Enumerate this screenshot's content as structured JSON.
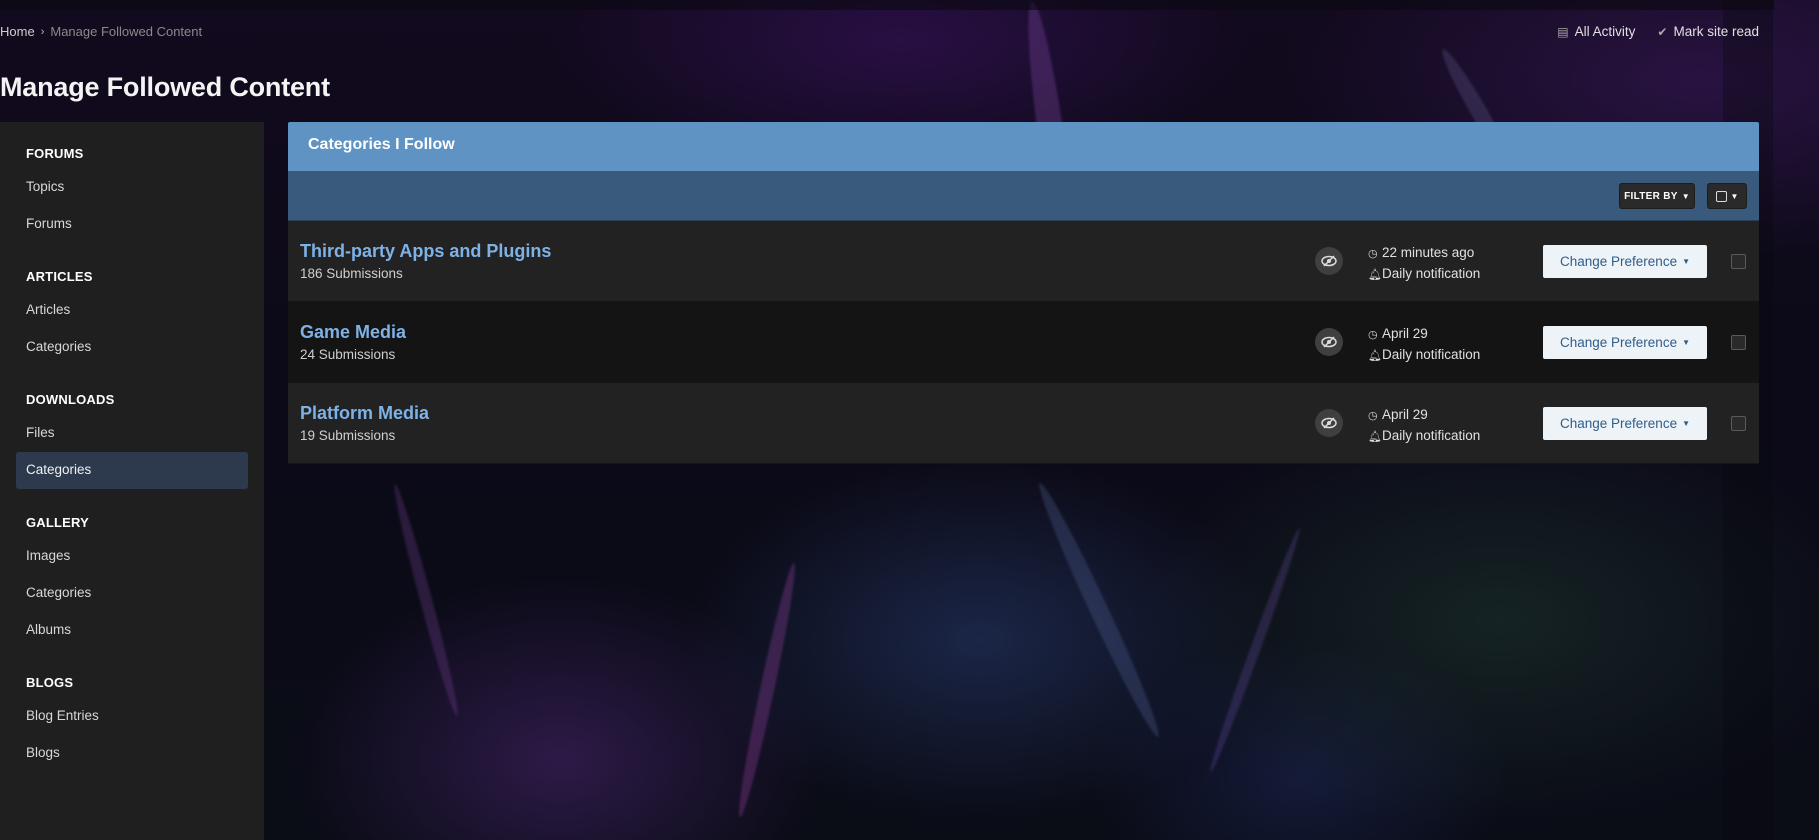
{
  "breadcrumb": {
    "home": "Home",
    "current": "Manage Followed Content"
  },
  "top_links": {
    "all_activity": "All Activity",
    "mark_read": "Mark site read"
  },
  "page_title": "Manage Followed Content",
  "sidebar": [
    {
      "heading": "FORUMS",
      "items": [
        "Topics",
        "Forums"
      ]
    },
    {
      "heading": "ARTICLES",
      "items": [
        "Articles",
        "Categories"
      ]
    },
    {
      "heading": "DOWNLOADS",
      "items": [
        "Files",
        "Categories"
      ]
    },
    {
      "heading": "GALLERY",
      "items": [
        "Images",
        "Categories",
        "Albums"
      ]
    },
    {
      "heading": "BLOGS",
      "items": [
        "Blog Entries",
        "Blogs"
      ]
    }
  ],
  "panel": {
    "title": "Categories I Follow",
    "filter_label": "FILTER BY",
    "rows": [
      {
        "title": "Third-party Apps and Plugins",
        "submissions": "186 Submissions",
        "time": "22 minutes ago",
        "notification": "Daily notification",
        "pref": "Change Preference"
      },
      {
        "title": "Game Media",
        "submissions": "24 Submissions",
        "time": "April 29",
        "notification": "Daily notification",
        "pref": "Change Preference"
      },
      {
        "title": "Platform Media",
        "submissions": "19 Submissions",
        "time": "April 29",
        "notification": "Daily notification",
        "pref": "Change Preference"
      }
    ]
  },
  "colors": {
    "panel_header": "#5f93c4",
    "panel_bar": "#395a7c",
    "link": "#7eb2e6",
    "active_nav": "#2d3a4e"
  },
  "icons": [
    "chevron-right-icon",
    "newspaper-icon",
    "check-icon",
    "caret-down-icon",
    "eye-slash-icon",
    "clock-icon",
    "bell-icon",
    "checkbox-icon"
  ]
}
